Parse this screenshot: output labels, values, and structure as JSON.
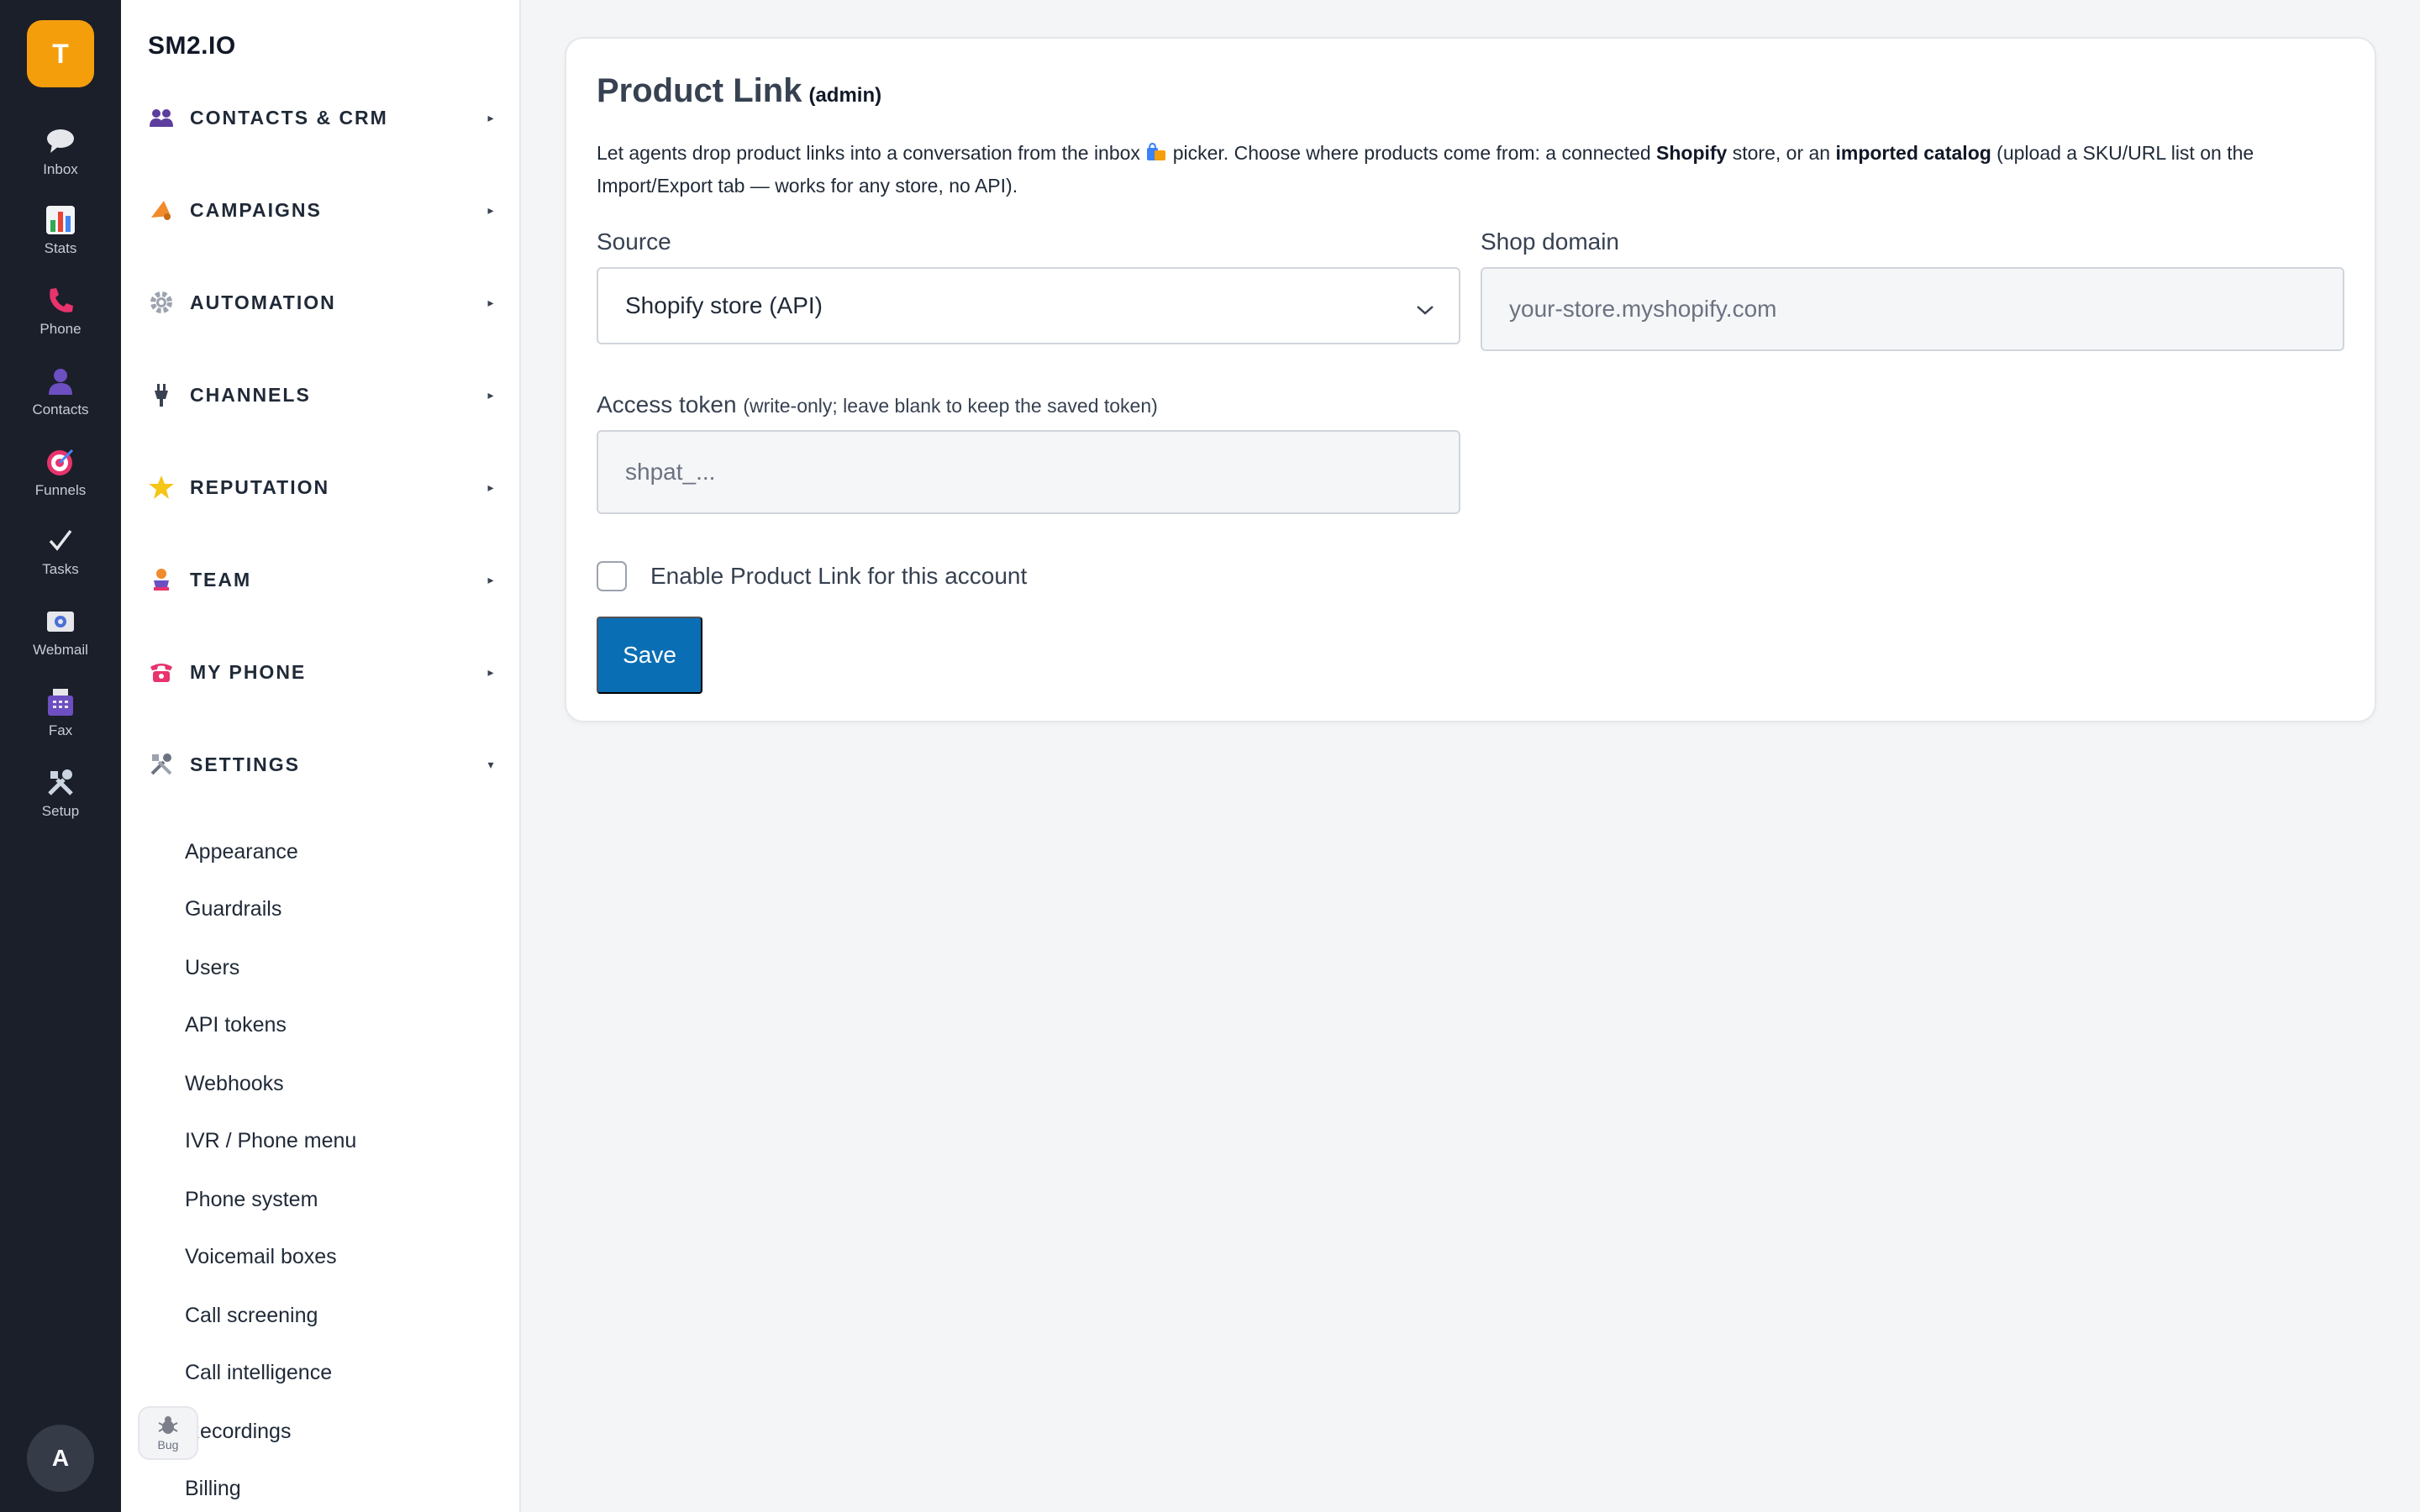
{
  "rail": {
    "logo_letter": "T",
    "items": [
      {
        "label": "Inbox",
        "icon": "speech-bubble-icon"
      },
      {
        "label": "Stats",
        "icon": "bar-chart-icon"
      },
      {
        "label": "Phone",
        "icon": "phone-icon"
      },
      {
        "label": "Contacts",
        "icon": "person-icon"
      },
      {
        "label": "Funnels",
        "icon": "target-icon"
      },
      {
        "label": "Tasks",
        "icon": "check-icon"
      },
      {
        "label": "Webmail",
        "icon": "mail-icon"
      },
      {
        "label": "Fax",
        "icon": "fax-icon"
      },
      {
        "label": "Setup",
        "icon": "tools-icon"
      }
    ],
    "avatar_letter": "A"
  },
  "nav": {
    "brand": "SM2.IO",
    "sections": [
      {
        "label": "CONTACTS & CRM",
        "icon": "people-icon",
        "caret": "▸"
      },
      {
        "label": "CAMPAIGNS",
        "icon": "megaphone-icon",
        "caret": "▸"
      },
      {
        "label": "AUTOMATION",
        "icon": "gear-icon",
        "caret": "▸"
      },
      {
        "label": "CHANNELS",
        "icon": "plug-icon",
        "caret": "▸"
      },
      {
        "label": "REPUTATION",
        "icon": "star-icon",
        "caret": "▸"
      },
      {
        "label": "TEAM",
        "icon": "trophy-icon",
        "caret": "▸"
      },
      {
        "label": "MY PHONE",
        "icon": "telephone-icon",
        "caret": "▸"
      },
      {
        "label": "SETTINGS",
        "icon": "tools-icon",
        "caret": "▾"
      }
    ],
    "settings_items": [
      "Appearance",
      "Guardrails",
      "Users",
      "API tokens",
      "Webhooks",
      "IVR / Phone menu",
      "Phone system",
      "Voicemail boxes",
      "Call screening",
      "Call intelligence",
      "Recordings",
      "Billing"
    ],
    "bug_label": "Bug"
  },
  "card": {
    "title": "Product Link",
    "title_tag": "(admin)",
    "desc": {
      "p1": "Let agents drop product links into a conversation from the inbox ",
      "p2": " picker. Choose where products come from: a connected ",
      "b1": "Shopify",
      "p3": " store, or an ",
      "b2": "imported catalog",
      "p4": " (upload a SKU/URL list on the Import/Export tab — works for any store, no API)."
    },
    "source_label": "Source",
    "source_value": "Shopify store (API)",
    "shop_label": "Shop domain",
    "shop_placeholder": "your-store.myshopify.com",
    "token_label": "Access token",
    "token_hint": "(write-only; leave blank to keep the saved token)",
    "token_placeholder": "shpat_...",
    "enable_label": "Enable Product Link for this account",
    "enable_checked": false,
    "save_label": "Save"
  },
  "colors": {
    "rail_bg": "#1b1f2a",
    "logo": "#f59e0b",
    "save_button": "#0a6eb4"
  }
}
